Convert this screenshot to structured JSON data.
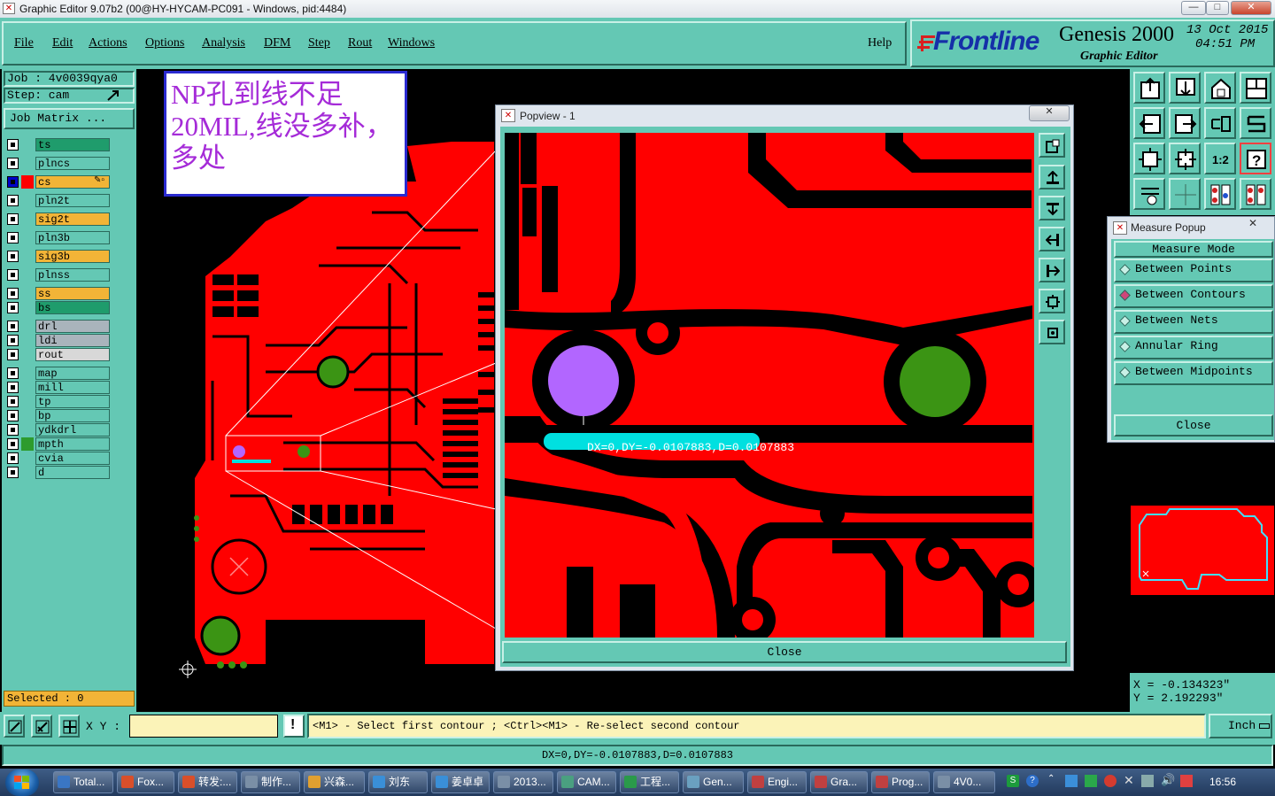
{
  "window": {
    "title": "Graphic Editor 9.07b2 (00@HY-HYCAM-PC091 - Windows, pid:4484)",
    "min": "—",
    "max": "□",
    "close": "✕"
  },
  "menu": {
    "items": [
      "File",
      "Edit",
      "Actions",
      "Options",
      "Analysis",
      "DFM",
      "Step",
      "Rout",
      "Windows"
    ],
    "help": "Help"
  },
  "brand": {
    "logo": "Frontline",
    "product": "Genesis 2000",
    "subtitle": "Graphic Editor",
    "date": "13 Oct 2015",
    "time": "04:51 PM"
  },
  "job": {
    "job_label": "Job : 4v0039qya0",
    "step_label": "Step: cam",
    "matrix_button": "Job Matrix ..."
  },
  "layers": [
    {
      "name": "ts",
      "color": "#1f9c6c",
      "state": "normal"
    },
    {
      "name": "plncs",
      "color": "#64c8b4",
      "state": "normal"
    },
    {
      "name": "cs",
      "color": "#f2b437",
      "state": "work"
    },
    {
      "name": "pln2t",
      "color": "#64c8b4",
      "state": "normal"
    },
    {
      "name": "sig2t",
      "color": "#f2b437",
      "state": "normal"
    },
    {
      "name": "pln3b",
      "color": "#64c8b4",
      "state": "normal"
    },
    {
      "name": "sig3b",
      "color": "#f2b437",
      "state": "normal"
    },
    {
      "name": "plnss",
      "color": "#64c8b4",
      "state": "normal"
    },
    {
      "name": "ss",
      "color": "#f2b437",
      "state": "normal"
    },
    {
      "name": "bs",
      "color": "#1f9c6c",
      "state": "normal"
    },
    {
      "name": "drl",
      "color": "#a9b4bc",
      "state": "normal"
    },
    {
      "name": "ldi",
      "color": "#a9b4bc",
      "state": "normal"
    },
    {
      "name": "rout",
      "color": "#d8d8d8",
      "state": "normal"
    },
    {
      "name": "map",
      "color": "#64c8b4",
      "state": "normal"
    },
    {
      "name": "mill",
      "color": "#64c8b4",
      "state": "normal"
    },
    {
      "name": "tp",
      "color": "#64c8b4",
      "state": "normal"
    },
    {
      "name": "bp",
      "color": "#64c8b4",
      "state": "normal"
    },
    {
      "name": "ydkdrl",
      "color": "#64c8b4",
      "state": "normal"
    },
    {
      "name": "mpth",
      "color": "#64c8b4",
      "state": "marked"
    },
    {
      "name": "cvia",
      "color": "#64c8b4",
      "state": "normal"
    },
    {
      "name": "d",
      "color": "#64c8b4",
      "state": "normal"
    }
  ],
  "selected_label": "Selected : 0",
  "annotation_note": "NP孔到线不足20MIL,线没多补，多处",
  "popview": {
    "title": "Popview - 1",
    "measure_text": "DX=0,DY=-0.0107883,D=0.0107883",
    "close": "Close"
  },
  "measure_popup": {
    "title": "Measure Popup",
    "mode_label": "Measure Mode",
    "options": [
      "Between Points",
      "Between Contours",
      "Between Nets",
      "Annular Ring",
      "Between Midpoints"
    ],
    "selected": "Between Contours",
    "close": "Close"
  },
  "coords": {
    "x": "X = -0.134323\"",
    "y": "Y = 2.192293\""
  },
  "command": {
    "xy_label": "X Y :",
    "xy_value": "",
    "prompt": "<M1> - Select first contour ; <Ctrl><M1> - Re-select second contour",
    "units": "Inch"
  },
  "status_message": "DX=0,DY=-0.0107883,D=0.0107883",
  "taskbar": {
    "items": [
      "Total...",
      "Fox...",
      "转发:...",
      "制作...",
      "兴森...",
      "刘东",
      "姜卓卓",
      "2013...",
      "CAM...",
      "工程...",
      "Gen...",
      "Engi...",
      "Gra...",
      "Prog...",
      "4V0..."
    ],
    "clock": "16:56"
  }
}
